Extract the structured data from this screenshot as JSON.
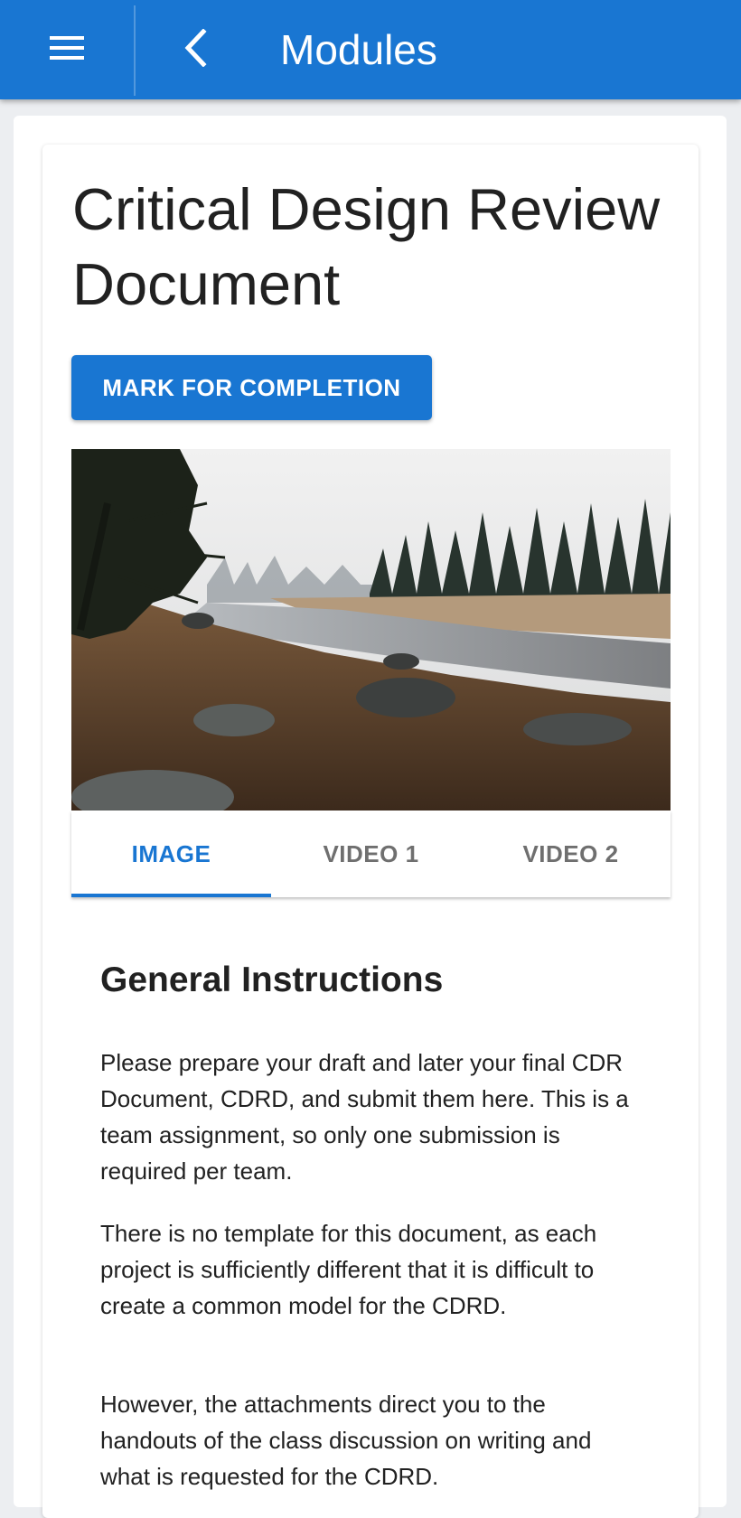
{
  "appbar": {
    "menu_icon": "hamburger-menu-icon",
    "back_icon": "chevron-left-icon",
    "title": "Modules",
    "color": "#1976d2"
  },
  "page": {
    "title": "Critical Design Review Document",
    "mark_button_label": "MARK FOR COMPLETION"
  },
  "media": {
    "tabs": [
      {
        "label": "IMAGE",
        "active": true
      },
      {
        "label": "VIDEO 1",
        "active": false
      },
      {
        "label": "VIDEO 2",
        "active": false
      }
    ]
  },
  "content": {
    "heading": "General Instructions",
    "paragraphs": [
      "Please prepare your draft and later your final CDR Document, CDRD, and submit them here. This is a team assignment, so only one submission is required per team.",
      "There is no template for this document, as each project is sufficiently different that it is difficult to create a common model for the CDRD.",
      "However, the attachments direct you to the handouts of the class discussion on writing and what is requested for the CDRD."
    ]
  }
}
